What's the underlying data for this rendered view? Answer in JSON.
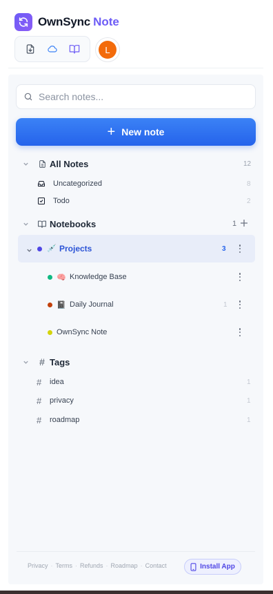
{
  "brand": {
    "name": "OwnSync",
    "accent": "Note"
  },
  "toolbar": {
    "icons": [
      "file-download-icon",
      "cloud-icon",
      "book-open-icon"
    ]
  },
  "user": {
    "avatar_initial": "L",
    "avatar_color": "#f36b0b"
  },
  "search": {
    "placeholder": "Search notes..."
  },
  "new_note": {
    "label": "New note"
  },
  "all_notes": {
    "label": "All Notes",
    "count": "12",
    "items": [
      {
        "label": "Uncategorized",
        "count": "8"
      },
      {
        "label": "Todo",
        "count": "2"
      }
    ]
  },
  "notebooks": {
    "label": "Notebooks",
    "count": "1",
    "items": [
      {
        "emoji": "💉",
        "label": "Projects",
        "count": "3",
        "dot_color": "#4f46e5",
        "active": true
      },
      {
        "emoji": "🧠",
        "label": "Knowledge Base",
        "count": "",
        "dot_color": "#10b981"
      },
      {
        "emoji": "📓",
        "label": "Daily Journal",
        "count": "1",
        "dot_color": "#c2410c"
      },
      {
        "emoji": "",
        "label": "OwnSync Note",
        "count": "",
        "dot_color": "#d4d40c"
      }
    ]
  },
  "tags": {
    "label": "Tags",
    "items": [
      {
        "symbol": "#",
        "label": "idea",
        "count": "1"
      },
      {
        "symbol": "#",
        "label": "privacy",
        "count": "1"
      },
      {
        "symbol": "#",
        "label": "roadmap",
        "count": "1"
      }
    ]
  },
  "footer": {
    "links": [
      "Privacy",
      "Terms",
      "Refunds",
      "Roadmap",
      "Contact"
    ],
    "separator": "·",
    "install_label": "Install App"
  },
  "colors": {
    "primary": "#2563eb",
    "brand_accent": "#6d5cf6",
    "active_bg": "#e8edf9"
  }
}
